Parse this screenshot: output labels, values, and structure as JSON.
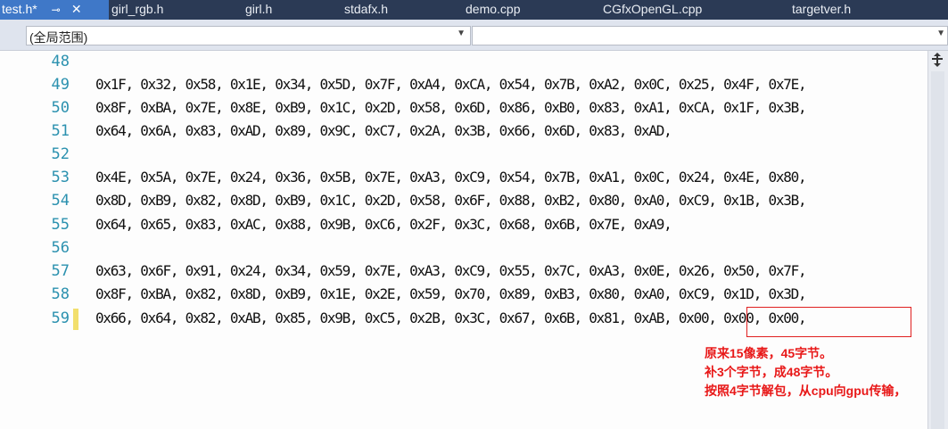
{
  "tabs": [
    {
      "label": "test.h*",
      "pin": "⊸",
      "close": "✕",
      "active": true
    },
    {
      "label": "girl_rgb.h"
    },
    {
      "label": "girl.h"
    },
    {
      "label": "stdafx.h"
    },
    {
      "label": "demo.cpp"
    },
    {
      "label": "CGfxOpenGL.cpp"
    },
    {
      "label": "targetver.h"
    }
  ],
  "navbar": {
    "scope_value": "(全局范围)",
    "member_value": ""
  },
  "editor": {
    "lines": [
      {
        "num": "48",
        "code": ""
      },
      {
        "num": "49",
        "code": "0x1F, 0x32, 0x58, 0x1E, 0x34, 0x5D, 0x7F, 0xA4, 0xCA, 0x54, 0x7B, 0xA2, 0x0C, 0x25, 0x4F, 0x7E,"
      },
      {
        "num": "50",
        "code": "0x8F, 0xBA, 0x7E, 0x8E, 0xB9, 0x1C, 0x2D, 0x58, 0x6D, 0x86, 0xB0, 0x83, 0xA1, 0xCA, 0x1F, 0x3B,"
      },
      {
        "num": "51",
        "code": "0x64, 0x6A, 0x83, 0xAD, 0x89, 0x9C, 0xC7, 0x2A, 0x3B, 0x66, 0x6D, 0x83, 0xAD,"
      },
      {
        "num": "52",
        "code": ""
      },
      {
        "num": "53",
        "code": "0x4E, 0x5A, 0x7E, 0x24, 0x36, 0x5B, 0x7E, 0xA3, 0xC9, 0x54, 0x7B, 0xA1, 0x0C, 0x24, 0x4E, 0x80,"
      },
      {
        "num": "54",
        "code": "0x8D, 0xB9, 0x82, 0x8D, 0xB9, 0x1C, 0x2D, 0x58, 0x6F, 0x88, 0xB2, 0x80, 0xA0, 0xC9, 0x1B, 0x3B,"
      },
      {
        "num": "55",
        "code": "0x64, 0x65, 0x83, 0xAC, 0x88, 0x9B, 0xC6, 0x2F, 0x3C, 0x68, 0x6B, 0x7E, 0xA9,"
      },
      {
        "num": "56",
        "code": ""
      },
      {
        "num": "57",
        "code": "0x63, 0x6F, 0x91, 0x24, 0x34, 0x59, 0x7E, 0xA3, 0xC9, 0x55, 0x7C, 0xA3, 0x0E, 0x26, 0x50, 0x7F,"
      },
      {
        "num": "58",
        "code": "0x8F, 0xBA, 0x82, 0x8D, 0xB9, 0x1E, 0x2E, 0x59, 0x70, 0x89, 0xB3, 0x80, 0xA0, 0xC9, 0x1D, 0x3D,"
      },
      {
        "num": "59",
        "code": "0x66, 0x64, 0x82, 0xAB, 0x85, 0x9B, 0xC5, 0x2B, 0x3C, 0x67, 0x6B, 0x81, 0xAB, 0x00, 0x00, 0x00,",
        "changed": true
      }
    ]
  },
  "annotation": {
    "lines": [
      "原来15像素，45字节。",
      "补3个字节，成48字节。",
      "按照4字节解包，从cpu向gpu传输，"
    ],
    "color": "#e81818"
  },
  "scrollbar": {
    "split_icon": "split-handle-icon"
  }
}
